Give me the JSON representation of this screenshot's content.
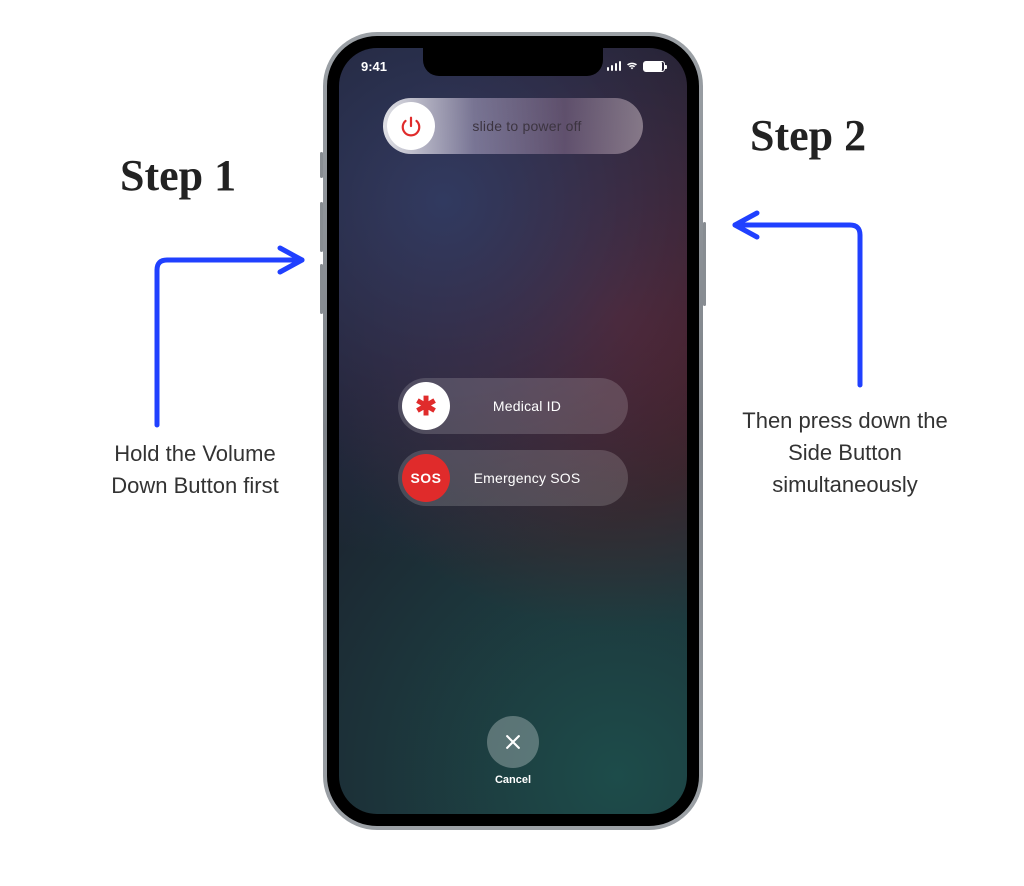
{
  "status": {
    "time": "9:41"
  },
  "sliders": {
    "power": {
      "label": "slide to power off"
    },
    "medical": {
      "label": "Medical ID",
      "knob_text": "✱"
    },
    "sos": {
      "label": "Emergency SOS",
      "knob_text": "SOS"
    }
  },
  "cancel": {
    "label": "Cancel"
  },
  "annotations": {
    "step1": {
      "heading": "Step 1",
      "body": "Hold the Volume Down Button first"
    },
    "step2": {
      "heading": "Step 2",
      "body": "Then press down the Side Button simultaneously"
    }
  }
}
